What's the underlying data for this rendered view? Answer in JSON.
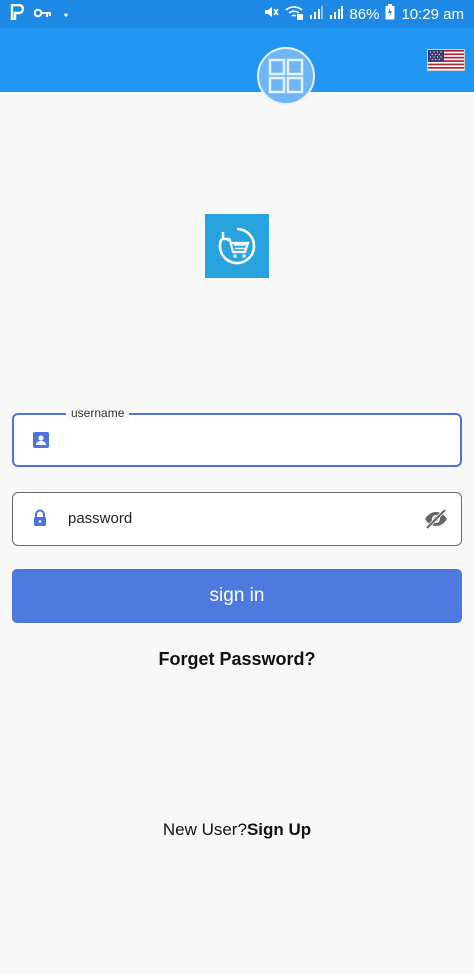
{
  "status_bar": {
    "battery_percent": "86%",
    "time": "10:29 am",
    "left_icons": [
      "pocket-casts-icon",
      "vpn-key-icon",
      "notification-dot-icon"
    ],
    "right_icons": [
      "mute-icon",
      "wifi-icon",
      "signal-icon",
      "signal-icon",
      "battery-icon"
    ]
  },
  "header": {
    "menu_icon": "grid-icon",
    "language_icon": "us-flag-icon",
    "bar_color": "#2196f3"
  },
  "logo": {
    "icon": "shopping-cart-icon",
    "color": "#29a3de"
  },
  "login_form": {
    "username": {
      "label": "username",
      "value": "",
      "icon": "contact-card-icon"
    },
    "password": {
      "placeholder": "password",
      "value": "",
      "icon": "lock-icon",
      "toggle_icon": "eye-off-icon"
    },
    "sign_in_label": "sign in",
    "accent_color": "#4e7ae0"
  },
  "forget_password_label": "Forget Password?",
  "signup": {
    "prompt": "New User?",
    "link": "Sign Up"
  }
}
